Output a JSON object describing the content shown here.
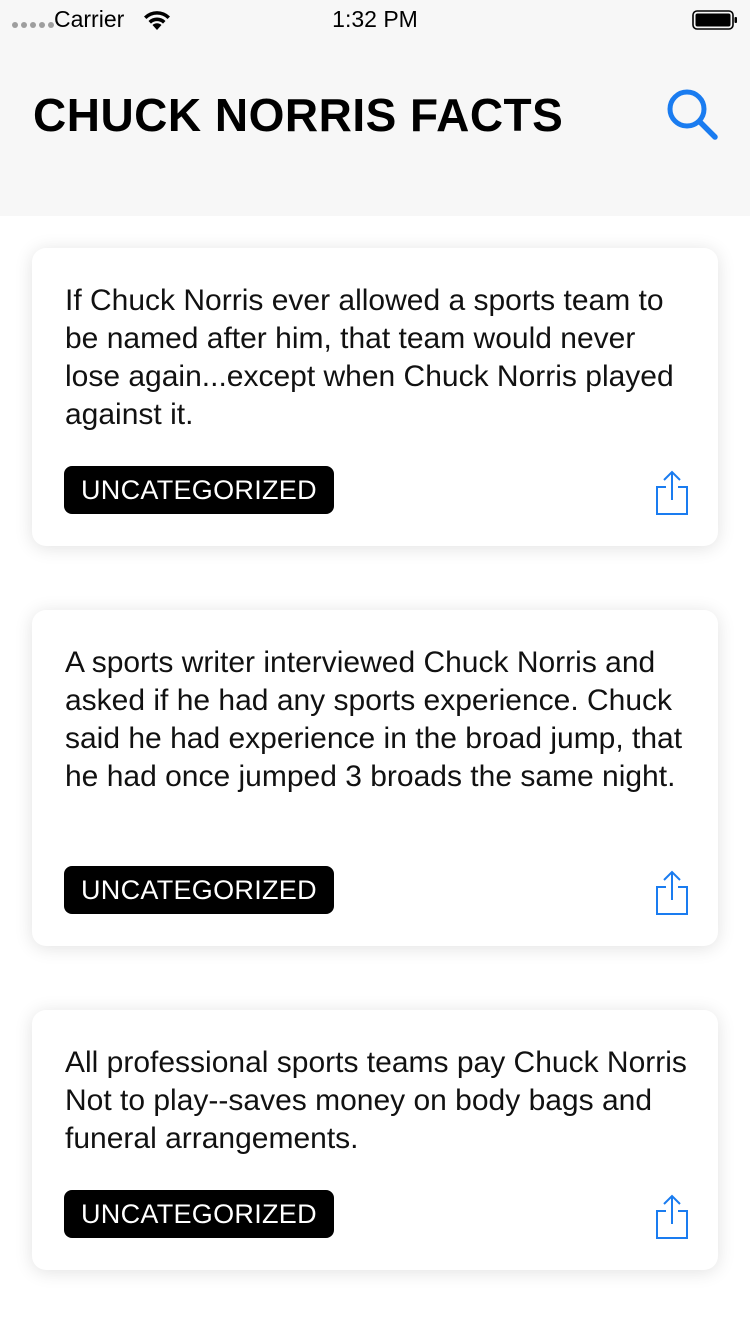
{
  "status_bar": {
    "carrier": "Carrier",
    "time": "1:32 PM"
  },
  "header": {
    "title": "CHUCK NORRIS FACTS",
    "search_icon": "search-icon"
  },
  "colors": {
    "accent": "#1a7cf0",
    "badge_bg": "#000000",
    "header_bg": "#f7f7f7"
  },
  "facts": [
    {
      "text": "If Chuck Norris ever allowed a sports team to be named after him, that team would never lose again...except when Chuck Norris played against it.",
      "category": "UNCATEGORIZED",
      "share_icon": "share-icon"
    },
    {
      "text": "A sports writer interviewed Chuck Norris and asked if he had any sports experience. Chuck said he had experience in the broad jump, that he had once jumped 3 broads the same night.",
      "category": "UNCATEGORIZED",
      "share_icon": "share-icon"
    },
    {
      "text": "All professional sports teams pay Chuck Norris Not to play--saves money on body bags and funeral arrangements.",
      "category": "UNCATEGORIZED",
      "share_icon": "share-icon"
    }
  ]
}
